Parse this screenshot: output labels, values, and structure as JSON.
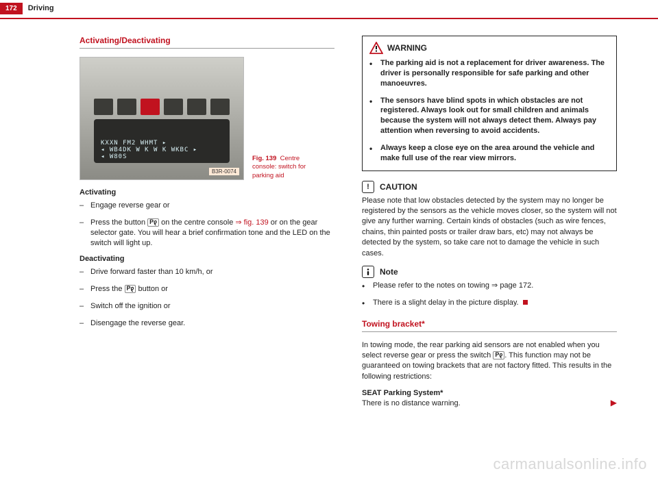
{
  "header": {
    "page_number": "172",
    "chapter": "Driving"
  },
  "left": {
    "section_heading": "Activating/Deactivating",
    "figure": {
      "code": "B3R-0074",
      "caption_label": "Fig. 139",
      "caption_text": "Centre console: switch for parking aid",
      "radio_line1": "KXXN    FM2       WHMT ▸",
      "radio_line2": "◂ WB4DK  W K W K   WKBC ▸",
      "radio_line3": "◂ W80S"
    },
    "activating_heading": "Activating",
    "activating_items": [
      {
        "text": "Engage reverse gear or"
      },
      {
        "prefix": "Press the button ",
        "icon": "P𐑞",
        "mid": " on the centre console ",
        "ref": "⇒ fig. 139",
        "suffix": " or on the gear selector gate. You will hear a brief confirmation tone and the LED on the switch will light up."
      }
    ],
    "deactivating_heading": "Deactivating",
    "deactivating_items": [
      "Drive forward faster than 10 km/h, or",
      {
        "prefix": "Press the ",
        "icon": "P𐑞",
        "suffix": " button or"
      },
      "Switch off the ignition or",
      "Disengage the reverse gear."
    ]
  },
  "right": {
    "warning": {
      "label": "WARNING",
      "items": [
        "The parking aid is not a replacement for driver awareness. The driver is personally responsible for safe parking and other manoeuvres.",
        "The sensors have blind spots in which obstacles are not registered. Always look out for small children and animals because the system will not always detect them. Always pay attention when reversing to avoid accidents.",
        "Always keep a close eye on the area around the vehicle and make full use of the rear view mirrors."
      ]
    },
    "caution": {
      "label": "CAUTION",
      "text": "Please note that low obstacles detected by the system may no longer be registered by the sensors as the vehicle moves closer, so the system will not give any further warning. Certain kinds of obstacles (such as wire fences, chains, thin painted posts or trailer draw bars, etc) may not always be detected by the system, so take care not to damage the vehicle in such cases."
    },
    "note": {
      "label": "Note",
      "items": [
        "Please refer to the notes on towing ⇒ page 172.",
        "There is a slight delay in the picture display."
      ]
    },
    "towing": {
      "heading": "Towing bracket*",
      "intro_prefix": "In towing mode, the rear parking aid sensors are not enabled when you select reverse gear or press the switch ",
      "icon": "P𐑞",
      "intro_suffix": ". This function may not be guaranteed on towing brackets that are not factory fitted. This results in the following restrictions:",
      "sub_heading": "SEAT Parking System*",
      "sub_text": "There is no distance warning."
    }
  },
  "watermark": "carmanualsonline.info"
}
